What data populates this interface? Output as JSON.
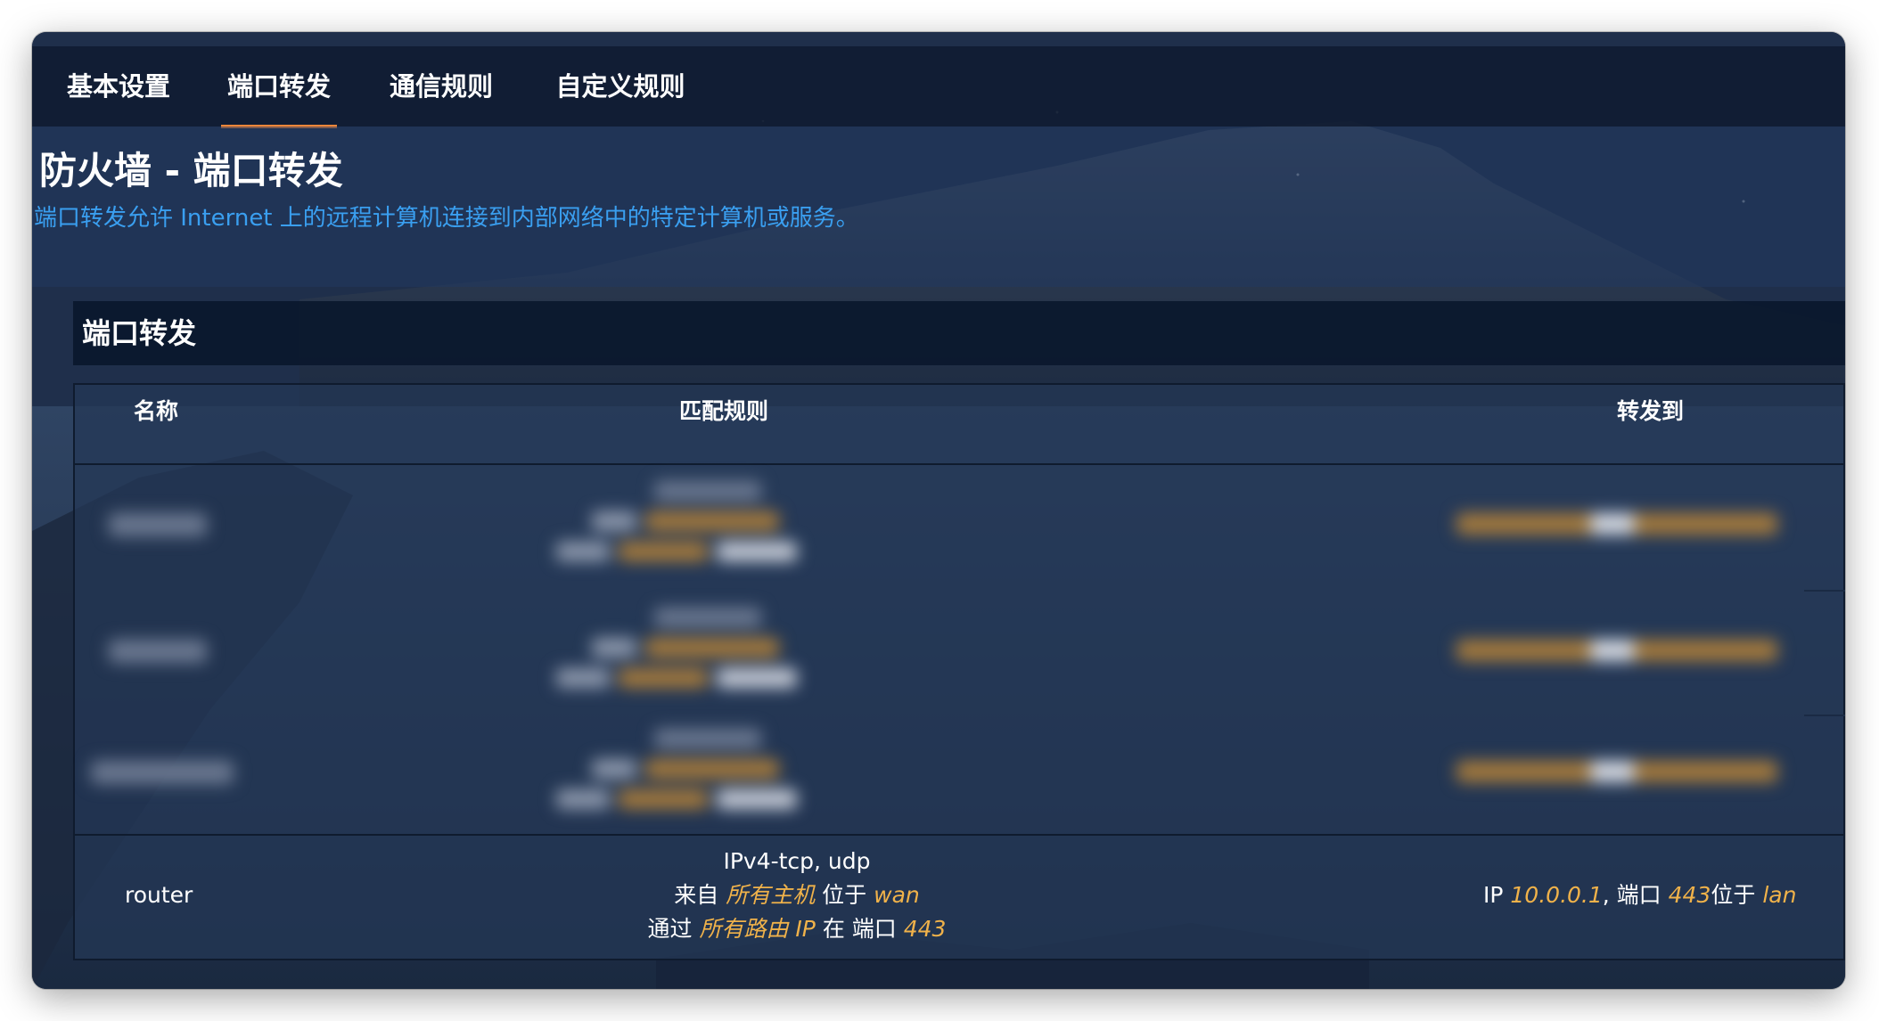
{
  "tabs": [
    {
      "label": "基本设置",
      "active": false
    },
    {
      "label": "端口转发",
      "active": true
    },
    {
      "label": "通信规则",
      "active": false
    },
    {
      "label": "自定义规则",
      "active": false
    }
  ],
  "page": {
    "title": "防火墙 - 端口转发",
    "description": "端口转发允许 Internet 上的远程计算机连接到内部网络中的特定计算机或服务。"
  },
  "section": {
    "title": "端口转发"
  },
  "table": {
    "headers": {
      "name": "名称",
      "match": "匹配规则",
      "forward": "转发到"
    },
    "visible_row": {
      "name": "router",
      "proto": "IPv4-tcp, udp",
      "from_prefix": "来自",
      "from_hosts": "所有主机",
      "from_mid": "位于",
      "from_zone": "wan",
      "via_prefix": "通过",
      "via_ip": "所有路由 IP",
      "via_mid": "在 端口",
      "via_port": "443",
      "fwd_prefix": "IP",
      "fwd_ip": "10.0.0.1",
      "fwd_mid": ", 端口",
      "fwd_port": "443",
      "fwd_mid2": "位于",
      "fwd_zone": "lan"
    }
  },
  "colors": {
    "accent": "#f0863a",
    "link": "#3a9ff0",
    "highlight": "#f0b24a"
  }
}
